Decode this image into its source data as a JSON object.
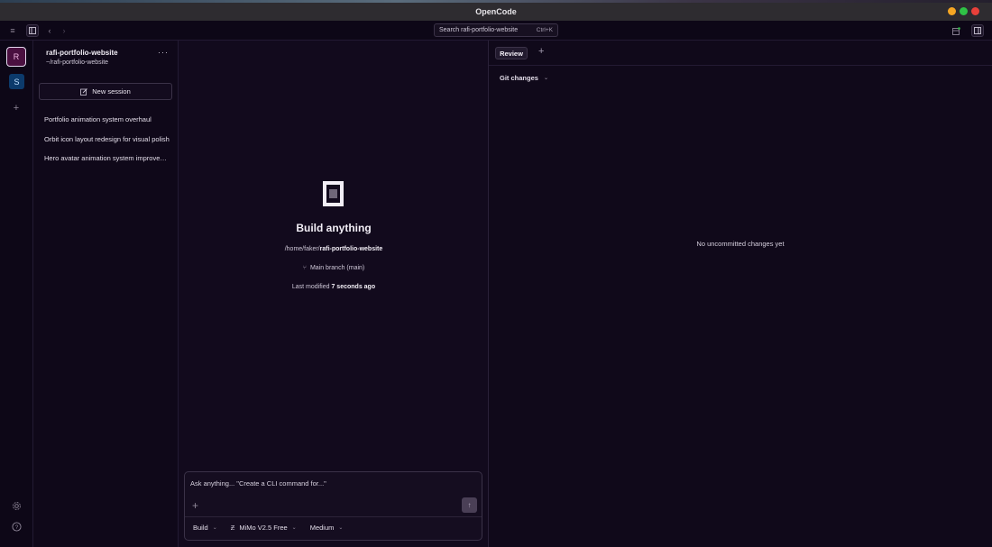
{
  "window": {
    "title": "OpenCode",
    "controls": [
      {
        "name": "minimize",
        "color": "#f5a623"
      },
      {
        "name": "maximize",
        "color": "#2fc246"
      },
      {
        "name": "close",
        "color": "#e8403a"
      }
    ]
  },
  "toolbar": {
    "search_label": "Search rafi-portfolio-website",
    "search_shortcut": "Ctrl+K"
  },
  "rail": {
    "projects": [
      {
        "initial": "R",
        "color": "#4a1040"
      },
      {
        "initial": "S",
        "color": "#0c3a6b"
      }
    ]
  },
  "sidebar": {
    "project_name": "rafi-portfolio-website",
    "project_path": "~/rafi-portfolio-website",
    "more_label": "···",
    "new_session_label": "New session",
    "sessions": [
      "Portfolio animation system overhaul",
      "Orbit icon layout redesign for visual polish",
      "Hero avatar animation system improvements"
    ]
  },
  "main": {
    "title": "Build anything",
    "path_prefix": "/home/faker/",
    "path_project": "rafi-portfolio-website",
    "branch": "Main branch (main)",
    "last_modified_label": "Last modified ",
    "last_modified_value": "7 seconds ago"
  },
  "composer": {
    "placeholder": "Ask anything... \"Create a CLI command for...\"",
    "mode": "Build",
    "model": "MiMo V2.5 Free",
    "effort": "Medium"
  },
  "review": {
    "tab_label": "Review",
    "filter_label": "Git changes",
    "empty_message": "No uncommitted changes yet"
  }
}
